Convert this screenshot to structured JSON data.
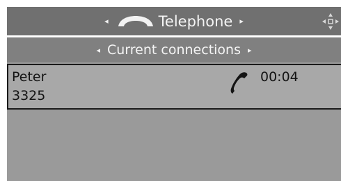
{
  "header": {
    "title": "Telephone",
    "left_arrow": "◂",
    "right_arrow": "▸",
    "icon": "handset-icon",
    "nav_icon": "four-way-nav-icon"
  },
  "subheader": {
    "title": "Current connections",
    "left_arrow": "◂",
    "right_arrow": "▸"
  },
  "connections": [
    {
      "name": "Peter",
      "number": "3325",
      "duration": "00:04",
      "icon": "active-call-icon"
    }
  ],
  "colors": {
    "header_bg": "#707070",
    "subheader_bg": "#808080",
    "row_bg": "#a8a8a8",
    "screen_bg": "#9a9a9a",
    "text_light": "#f4f4f4",
    "text_dark": "#141414"
  }
}
